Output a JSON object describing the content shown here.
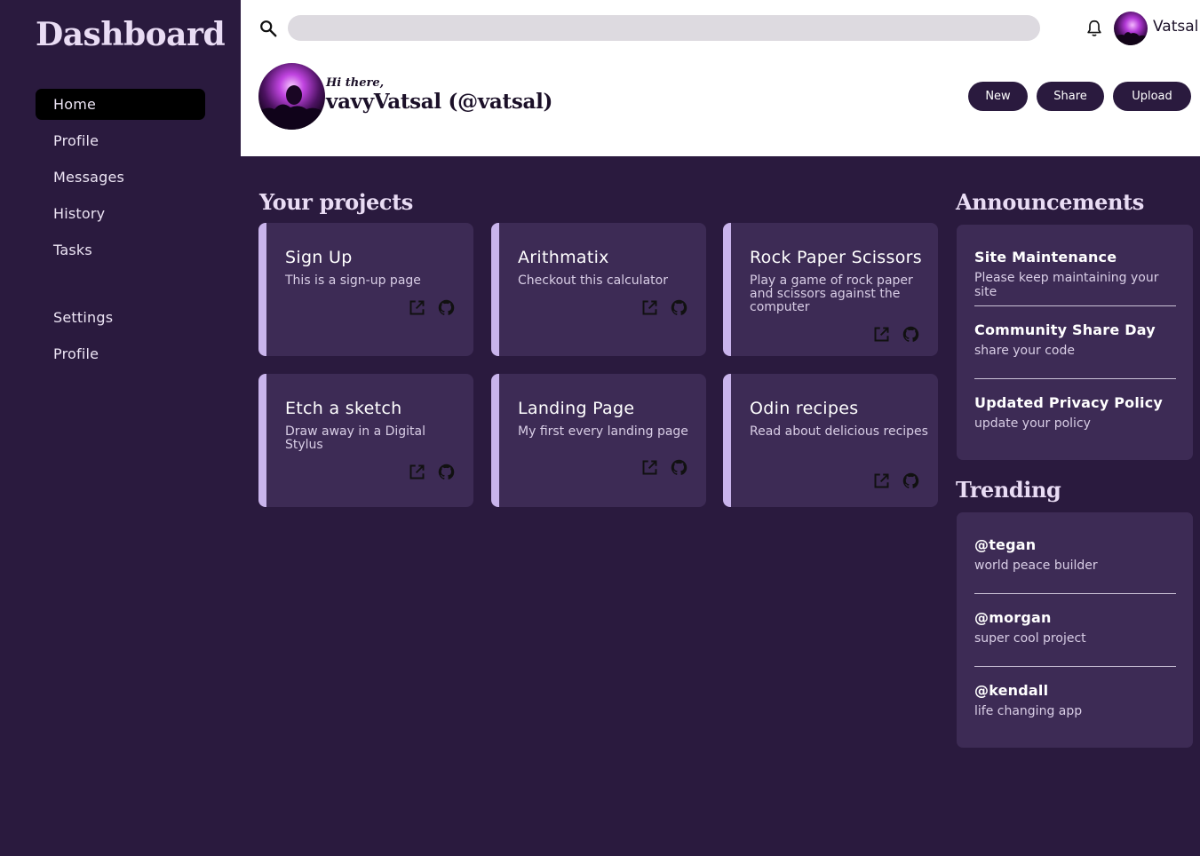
{
  "sidebar": {
    "brand": "Dashboard",
    "items": [
      {
        "label": "Home"
      },
      {
        "label": "Profile"
      },
      {
        "label": "Messages"
      },
      {
        "label": "History"
      },
      {
        "label": "Tasks"
      },
      {
        "label": "Settings"
      },
      {
        "label": "Profile"
      }
    ]
  },
  "header": {
    "search_placeholder": "",
    "username": "Vatsal",
    "greeting": "Hi there,",
    "fullname": "vavyVatsal (@vatsal)",
    "buttons": {
      "new": "New",
      "share": "Share",
      "upload": "Upload"
    }
  },
  "projects": {
    "title": "Your projects",
    "cards": [
      {
        "title": "Sign Up",
        "description": "This is a sign-up page"
      },
      {
        "title": "Arithmatix",
        "description": "Checkout this calculator"
      },
      {
        "title": "Rock Paper Scissors",
        "description": "Play a game of rock paper and scissors against the computer"
      },
      {
        "title": "Etch a sketch",
        "description": "Draw away in a Digital Stylus"
      },
      {
        "title": "Landing Page",
        "description": "My first every landing page"
      },
      {
        "title": "Odin recipes",
        "description": "Read about delicious recipes"
      }
    ]
  },
  "announcements": {
    "title": "Announcements",
    "items": [
      {
        "title": "Site Maintenance",
        "subtitle": "Please keep maintaining your site"
      },
      {
        "title": "Community Share Day",
        "subtitle": "share your code"
      },
      {
        "title": "Updated Privacy Policy",
        "subtitle": "update your policy"
      }
    ]
  },
  "trending": {
    "title": "Trending",
    "items": [
      {
        "title": "@tegan",
        "subtitle": "world peace builder"
      },
      {
        "title": "@morgan",
        "subtitle": "super cool project"
      },
      {
        "title": "@kendall",
        "subtitle": "life changing app"
      }
    ]
  },
  "colors": {
    "background": "#2a1a3e",
    "card": "#3d2b55",
    "accent": "#c9b4ec",
    "header": "#ffffff"
  },
  "icons": [
    "search-icon",
    "bell-icon",
    "external-link-icon",
    "github-icon"
  ]
}
